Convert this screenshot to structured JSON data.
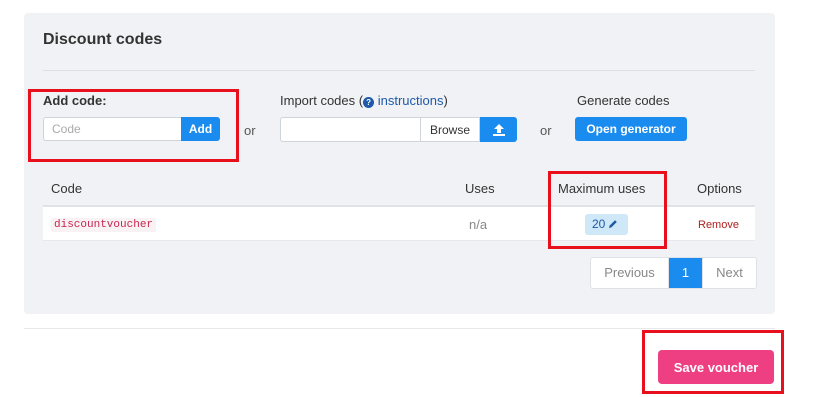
{
  "panel": {
    "title": "Discount codes"
  },
  "add_code": {
    "label": "Add code:",
    "input_value": "",
    "input_placeholder": "Code",
    "button_label": "Add"
  },
  "separator": {
    "or": "or"
  },
  "import_codes": {
    "label_prefix": "Import codes (",
    "help_icon": "?",
    "link_text": "instructions",
    "label_suffix": ")",
    "browse_label": "Browse",
    "upload_icon": "upload-icon"
  },
  "generate_codes": {
    "label": "Generate codes",
    "button_label": "Open generator"
  },
  "table": {
    "headers": {
      "code": "Code",
      "uses": "Uses",
      "max_uses": "Maximum uses",
      "options": "Options"
    },
    "rows": [
      {
        "code": "discountvoucher",
        "uses": "n/a",
        "max_uses": "20",
        "option": "Remove"
      }
    ]
  },
  "pagination": {
    "previous": "Previous",
    "current": "1",
    "next": "Next"
  },
  "footer": {
    "save_label": "Save voucher"
  },
  "colors": {
    "primary": "#1a8cf0",
    "save": "#ee3f82",
    "highlight": "#e8101c",
    "panel_bg": "#f0f2f5"
  }
}
